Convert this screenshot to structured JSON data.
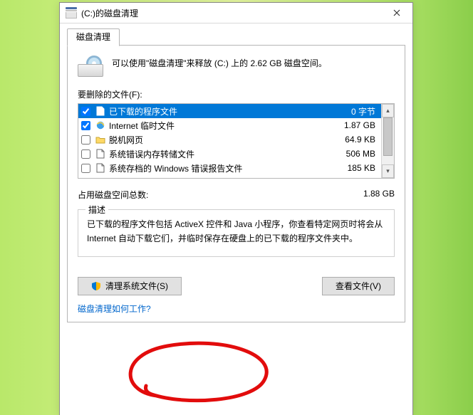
{
  "window": {
    "title": "(C:)的磁盘清理"
  },
  "tabs": [
    "磁盘清理"
  ],
  "summary": "可以使用\"磁盘清理\"来释放  (C:) 上的 2.62 GB 磁盘空间。",
  "filesLabel": "要删除的文件(F):",
  "files": [
    {
      "checked": true,
      "icon": "page",
      "name": "已下载的程序文件",
      "size": "0 字节",
      "selected": true
    },
    {
      "checked": true,
      "icon": "ie",
      "name": "Internet 临时文件",
      "size": "1.87 GB",
      "selected": false
    },
    {
      "checked": false,
      "icon": "folder",
      "name": "脱机网页",
      "size": "64.9 KB",
      "selected": false
    },
    {
      "checked": false,
      "icon": "page",
      "name": "系统错误内存转储文件",
      "size": "506 MB",
      "selected": false
    },
    {
      "checked": false,
      "icon": "page",
      "name": "系统存档的 Windows 错误报告文件",
      "size": "185 KB",
      "selected": false
    }
  ],
  "totalLabel": "占用磁盘空间总数:",
  "totalValue": "1.88 GB",
  "descLegend": "描述",
  "descText": "已下载的程序文件包括 ActiveX 控件和 Java 小程序，你查看特定网页时将会从 Internet 自动下载它们，并临时保存在硬盘上的已下载的程序文件夹中。",
  "buttons": {
    "cleanSystem": "清理系统文件(S)",
    "viewFiles": "查看文件(V)"
  },
  "helpLink": "磁盘清理如何工作?"
}
